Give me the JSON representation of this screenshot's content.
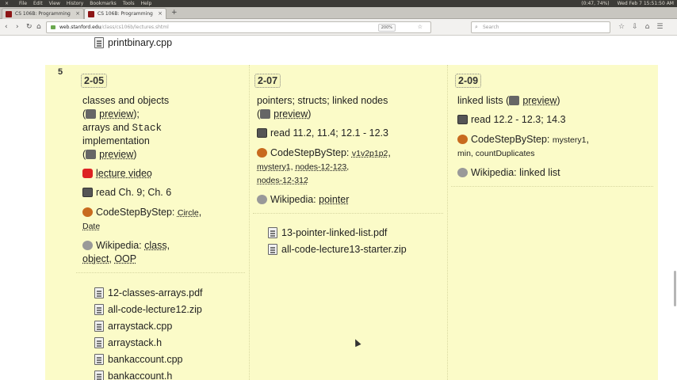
{
  "menubar": {
    "items": [
      "File",
      "Edit",
      "View",
      "History",
      "Bookmarks",
      "Tools",
      "Help"
    ],
    "battery": "(0:47, 74%)",
    "datetime": "Wed Feb 7  15:51:50 AM",
    "close": "×"
  },
  "tabs": [
    {
      "title": "CS 106B: Programming",
      "close": "×"
    },
    {
      "title": "CS 106B: Programming",
      "close": "×"
    }
  ],
  "newtab": "+",
  "nav": {
    "back": "‹",
    "forward": "›",
    "reload": "↻",
    "home": "⌂",
    "url_host": "web.stanford.edu",
    "url_path": "/class/cs106b/lectures.shtml",
    "zoom": "200%",
    "search_placeholder": "Search",
    "toolbar_icons": [
      "☆",
      "⇩",
      "⌂",
      "☰"
    ]
  },
  "prev_file": "printbinary.cpp",
  "row": {
    "week": "5",
    "lectures": [
      {
        "badge": "2-05",
        "title_line1": "classes and objects",
        "preview_label": "preview",
        "title_line2": "arrays and",
        "title_mono": "Stack",
        "title_line3": "implementation",
        "video_label": "lecture video",
        "read_label": "read Ch. 9; Ch. 6",
        "cs_label": "CodeStepByStep:",
        "cs_links": [
          "Circle",
          "Date"
        ],
        "wiki_label": "Wikipedia:",
        "wiki_links": [
          "class",
          "object",
          "OOP"
        ],
        "files": [
          "12-classes-arrays.pdf",
          "all-code-lecture12.zip",
          "arraystack.cpp",
          "arraystack.h",
          "bankaccount.cpp",
          "bankaccount.h"
        ]
      },
      {
        "badge": "2-07",
        "title": "pointers; structs; linked nodes",
        "preview_label": "preview",
        "read_label": "read 11.2, 11.4; 12.1 - 12.3",
        "cs_label": "CodeStepByStep:",
        "cs_links": [
          "v1v2p1p2",
          "mystery1",
          "nodes-12-123",
          "nodes-12-312"
        ],
        "wiki_label": "Wikipedia:",
        "wiki_links": [
          "pointer"
        ],
        "files": [
          "13-pointer-linked-list.pdf",
          "all-code-lecture13-starter.zip"
        ]
      },
      {
        "badge": "2-09",
        "title": "linked lists",
        "preview_label": "preview",
        "read_label": "read 12.2 - 12.3; 14.3",
        "cs_label": "CodeStepByStep:",
        "cs_links": [
          "mystery1",
          "min",
          "countDuplicates"
        ],
        "wiki_label": "Wikipedia:",
        "wiki_links": [
          "linked list"
        ]
      }
    ]
  }
}
